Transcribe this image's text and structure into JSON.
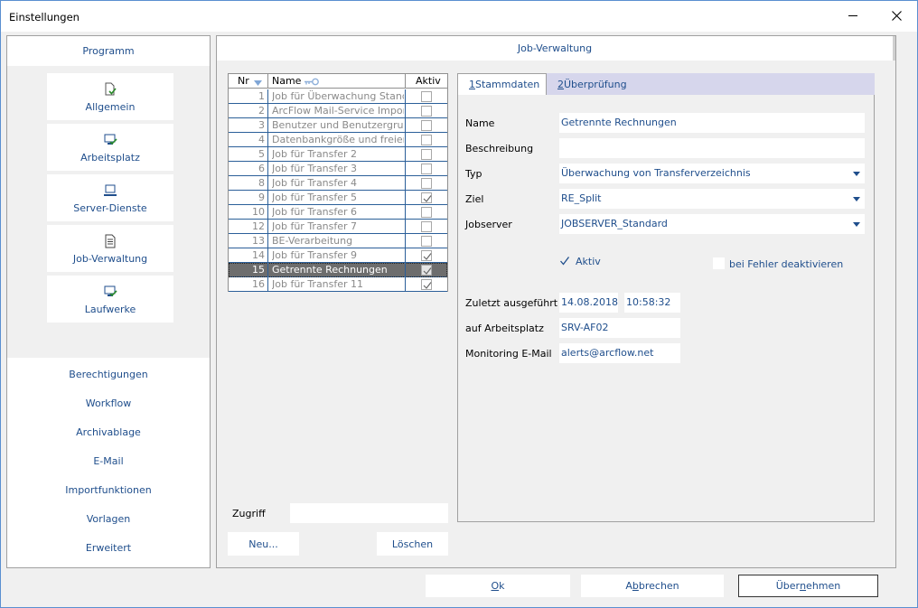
{
  "window": {
    "title": "Einstellungen"
  },
  "sidebar": {
    "header": "Programm",
    "tiles": [
      {
        "label": "Allgemein",
        "icon": "document-check-icon"
      },
      {
        "label": "Arbeitsplatz",
        "icon": "monitor-check-icon"
      },
      {
        "label": "Server-Dienste",
        "icon": "computer-icon"
      },
      {
        "label": "Job-Verwaltung",
        "icon": "document-list-icon"
      },
      {
        "label": "Laufwerke",
        "icon": "monitor-check-icon"
      }
    ],
    "links": [
      "Berechtigungen",
      "Workflow",
      "Archivablage",
      "E-Mail",
      "Importfunktionen",
      "Vorlagen",
      "Erweitert"
    ]
  },
  "main": {
    "header": "Job-Verwaltung",
    "joblist": {
      "columns": {
        "nr": "Nr",
        "name": "Name",
        "active": "Aktiv"
      },
      "rows": [
        {
          "nr": "1",
          "name": "Job für Überwachung Standard",
          "active": false,
          "selected": false
        },
        {
          "nr": "2",
          "name": "ArcFlow Mail-Service Import",
          "active": false,
          "selected": false
        },
        {
          "nr": "3",
          "name": "Benutzer und Benutzergruppen",
          "active": false,
          "selected": false
        },
        {
          "nr": "4",
          "name": "Datenbankgröße und freien",
          "active": false,
          "selected": false
        },
        {
          "nr": "5",
          "name": "Job für Transfer 2",
          "active": false,
          "selected": false
        },
        {
          "nr": "6",
          "name": "Job für Transfer 3",
          "active": false,
          "selected": false
        },
        {
          "nr": "8",
          "name": "Job für Transfer 4",
          "active": false,
          "selected": false
        },
        {
          "nr": "9",
          "name": "Job für Transfer 5",
          "active": true,
          "selected": false
        },
        {
          "nr": "10",
          "name": "Job für Transfer 6",
          "active": false,
          "selected": false
        },
        {
          "nr": "12",
          "name": "Job für Transfer 7",
          "active": false,
          "selected": false
        },
        {
          "nr": "13",
          "name": "BE-Verarbeitung",
          "active": false,
          "selected": false
        },
        {
          "nr": "14",
          "name": "Job für Transfer 9",
          "active": true,
          "selected": false
        },
        {
          "nr": "15",
          "name": "Getrennte Rechnungen",
          "active": true,
          "selected": true
        },
        {
          "nr": "16",
          "name": "Job für Transfer 11",
          "active": true,
          "selected": false
        }
      ]
    },
    "access_label": "Zugriff",
    "access_value": "",
    "new_button": "Neu...",
    "delete_button": "Löschen",
    "tabs": [
      {
        "key": "1",
        "label": " Stammdaten"
      },
      {
        "key": "2",
        "label": " Überprüfung"
      }
    ],
    "form": {
      "name_label": "Name",
      "name_value": "Getrennte Rechnungen",
      "description_label": "Beschreibung",
      "description_value": "",
      "type_label": "Typ",
      "type_value": "Überwachung von Transferverzeichnis",
      "target_label": "Ziel",
      "target_value": "RE_Split",
      "jobserver_label": "Jobserver",
      "jobserver_value": "JOBSERVER_Standard",
      "active_label": "Aktiv",
      "active_checked": true,
      "disable_on_error_label": "bei Fehler deaktivieren",
      "disable_on_error_checked": false,
      "last_run_label": "Zuletzt ausgeführt",
      "last_run_date": "14.08.2018",
      "last_run_time": "10:58:32",
      "workstation_label": "auf Arbeitsplatz",
      "workstation_value": "SRV-AF02",
      "monitoring_label": "Monitoring E-Mail",
      "monitoring_value": "alerts@arcflow.net"
    }
  },
  "footer": {
    "ok_key": "O",
    "ok_rest": "k",
    "cancel_pre": "A",
    "cancel_key": "b",
    "cancel_rest": "brechen",
    "apply_pre": "Über",
    "apply_key": "n",
    "apply_rest": "ehmen"
  },
  "colors": {
    "accent": "#1f4e8c",
    "tab_bg": "#d6d6ec",
    "selection": "#6d6d6d"
  }
}
